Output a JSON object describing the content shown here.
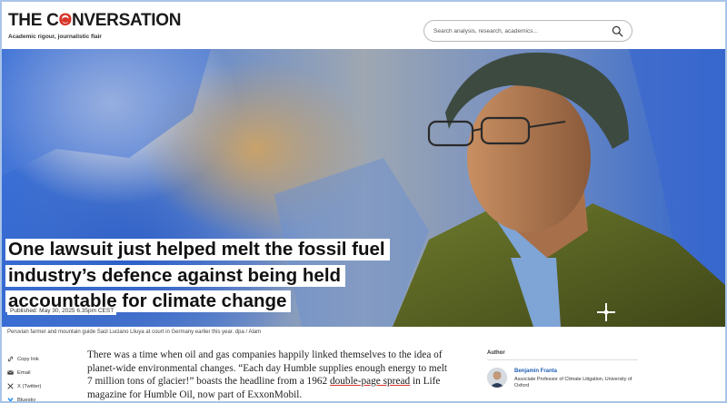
{
  "header": {
    "logo_text_before": "THE C",
    "logo_text_o": "O",
    "logo_text_after": "NVERSATION",
    "tagline": "Academic rigour, journalistic flair",
    "search_placeholder": "Search analysis, research, academics...",
    "search_icon": "search-icon"
  },
  "article": {
    "headline_lines": [
      "One lawsuit just helped melt the fossil fuel",
      "industry’s defence against being held",
      "accountable for climate change"
    ],
    "published": "Published: May 30, 2025 6.35pm CEST",
    "caption": "Peruvian farmer and mountain guide Saúl Luciano Lliuya at court in Germany earlier this year. dpa / Alam",
    "body_part1": "There was a time when oil and gas companies happily linked themselves to the idea of planet-wide environmental changes. “Each day Humble supplies enough energy to melt 7 million tons of glacier!” boasts the headline from a 1962 ",
    "body_link": "double-page spread",
    "body_part2": " in Life magazine for Humble Oil, now part of ExxonMobil."
  },
  "share": [
    {
      "label": "Copy link",
      "icon": "link-icon"
    },
    {
      "label": "Email",
      "icon": "email-icon"
    },
    {
      "label": "X (Twitter)",
      "icon": "x-icon"
    },
    {
      "label": "Bluesky",
      "icon": "bluesky-icon"
    }
  ],
  "author": {
    "section_label": "Author",
    "name": "Benjamin Franta",
    "role": "Associate Professor of Climate Litigation, University of Oxford"
  },
  "colors": {
    "brand_red": "#d8352a",
    "author_link": "#1f5fb5",
    "frame": "#a9c4e8"
  }
}
